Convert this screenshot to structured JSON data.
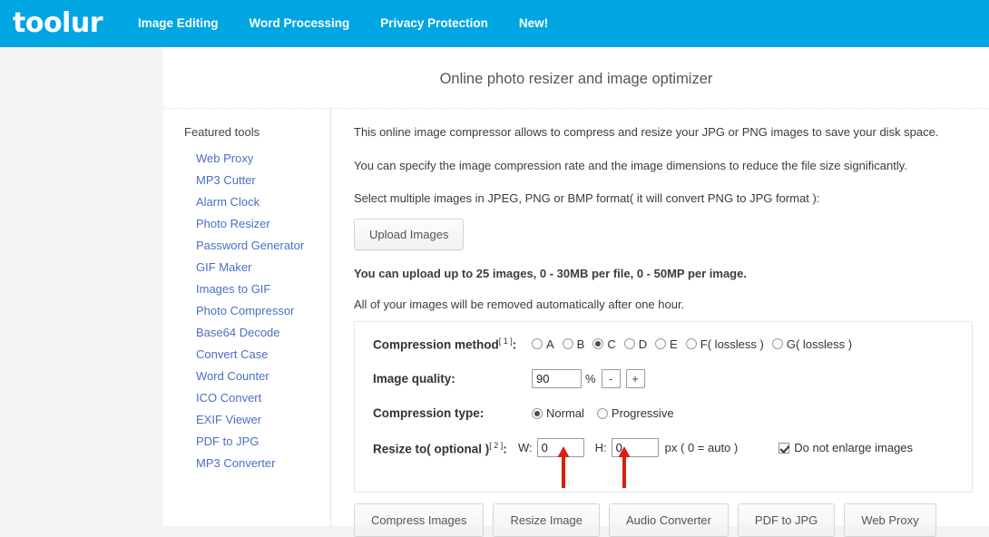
{
  "navbar": {
    "logo": "toolur",
    "links": [
      {
        "label": "Image Editing"
      },
      {
        "label": "Word Processing"
      },
      {
        "label": "Privacy Protection"
      },
      {
        "label": "New!"
      }
    ],
    "background_color": "#00a6e2"
  },
  "page": {
    "title": "Online photo resizer and image optimizer"
  },
  "sidebar": {
    "heading": "Featured tools",
    "items": [
      {
        "label": "Web Proxy"
      },
      {
        "label": "MP3 Cutter"
      },
      {
        "label": "Alarm Clock"
      },
      {
        "label": "Photo Resizer"
      },
      {
        "label": "Password Generator"
      },
      {
        "label": "GIF Maker"
      },
      {
        "label": "Images to GIF"
      },
      {
        "label": "Photo Compressor"
      },
      {
        "label": "Base64 Decode"
      },
      {
        "label": "Convert Case"
      },
      {
        "label": "Word Counter"
      },
      {
        "label": "ICO Convert"
      },
      {
        "label": "EXIF Viewer"
      },
      {
        "label": "PDF to JPG"
      },
      {
        "label": "MP3 Converter"
      }
    ],
    "link_color": "#4a6fc4"
  },
  "main": {
    "paragraphs": {
      "intro": "This online image compressor allows to compress and resize your JPG or PNG images to save your disk space.",
      "rate": "You can specify the image compression rate and the image dimensions to reduce the file size significantly.",
      "select": "Select multiple images in JPEG, PNG or BMP format( it will convert PNG to JPG format ):",
      "limits": "You can upload up to 25 images, 0 - 30MB per file, 0 - 50MP per image.",
      "retention": "All of your images will be removed automatically after one hour."
    },
    "upload_button": "Upload Images"
  },
  "options": {
    "compression_method": {
      "label": "Compression method",
      "superscript": "[ 1 ]",
      "suffix": ":",
      "selected": "C",
      "choices": [
        {
          "label": "A",
          "checked": false
        },
        {
          "label": "B",
          "checked": false
        },
        {
          "label": "C",
          "checked": true
        },
        {
          "label": "D",
          "checked": false
        },
        {
          "label": "E",
          "checked": false
        },
        {
          "label": "F( lossless )",
          "checked": false
        },
        {
          "label": "G( lossless )",
          "checked": false
        }
      ]
    },
    "image_quality": {
      "label": "Image quality:",
      "value": "90",
      "unit": "%",
      "decrement_label": "-",
      "increment_label": "+"
    },
    "compression_type": {
      "label": "Compression type:",
      "selected": "Normal",
      "choices": [
        {
          "label": "Normal",
          "checked": true
        },
        {
          "label": "Progressive",
          "checked": false
        }
      ]
    },
    "resize_to": {
      "label": "Resize to( optional )",
      "superscript": "[ 2 ]",
      "suffix": ":",
      "width_prefix": "W:",
      "width_value": "0",
      "height_prefix": "H:",
      "height_value": "0",
      "unit_note": "px ( 0 = auto )",
      "do_not_enlarge_label": "Do not enlarge images",
      "do_not_enlarge_checked": true
    }
  },
  "bottom_buttons": [
    {
      "label": "Compress Images"
    },
    {
      "label": "Resize Image"
    },
    {
      "label": "Audio Converter"
    },
    {
      "label": "PDF to JPG"
    },
    {
      "label": "Web Proxy"
    }
  ],
  "annotations": {
    "arrow_color": "#d91f11",
    "arrows": [
      {
        "name": "arrow-to-width-input"
      },
      {
        "name": "arrow-to-height-input"
      }
    ]
  }
}
